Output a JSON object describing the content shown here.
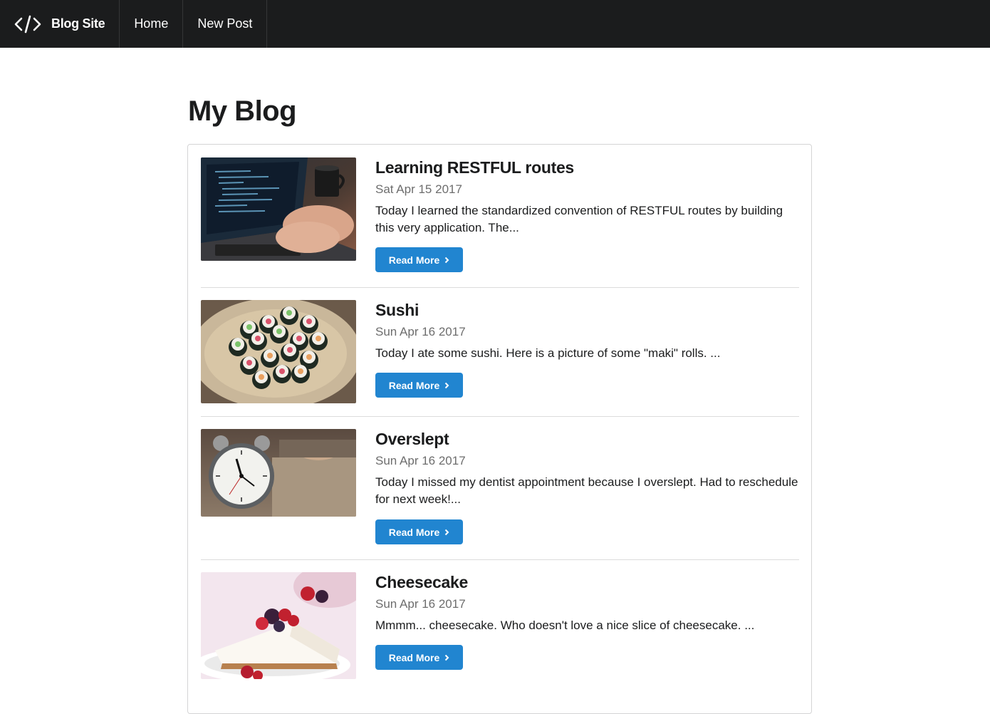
{
  "nav": {
    "brand_icon": "code-icon",
    "brand_label": "Blog Site",
    "items": [
      {
        "label": "Home"
      },
      {
        "label": "New Post"
      }
    ]
  },
  "page": {
    "title": "My Blog"
  },
  "posts": [
    {
      "title": "Learning RESTFUL routes",
      "date": "Sat Apr 15 2017",
      "excerpt": "Today I learned the standardized convention of RESTFUL routes by building this very application. The...",
      "image": "laptop-coding-photo",
      "button_label": "Read More"
    },
    {
      "title": "Sushi",
      "date": "Sun Apr 16 2017",
      "excerpt": "Today I ate some sushi. Here is a picture of some \"maki\" rolls. ...",
      "image": "sushi-plate-photo",
      "button_label": "Read More"
    },
    {
      "title": "Overslept",
      "date": "Sun Apr 16 2017",
      "excerpt": "Today I missed my dentist appointment because I overslept. Had to reschedule for next week!...",
      "image": "alarm-clock-photo",
      "button_label": "Read More"
    },
    {
      "title": "Cheesecake",
      "date": "Sun Apr 16 2017",
      "excerpt": "Mmmm... cheesecake. Who doesn't love a nice slice of cheesecake. ...",
      "image": "cheesecake-photo",
      "button_label": "Read More"
    }
  ],
  "colors": {
    "navbar_bg": "#1b1c1d",
    "button_primary": "#2185d0",
    "text_dark": "#1b1c1d",
    "text_muted": "#6d6d6d"
  }
}
